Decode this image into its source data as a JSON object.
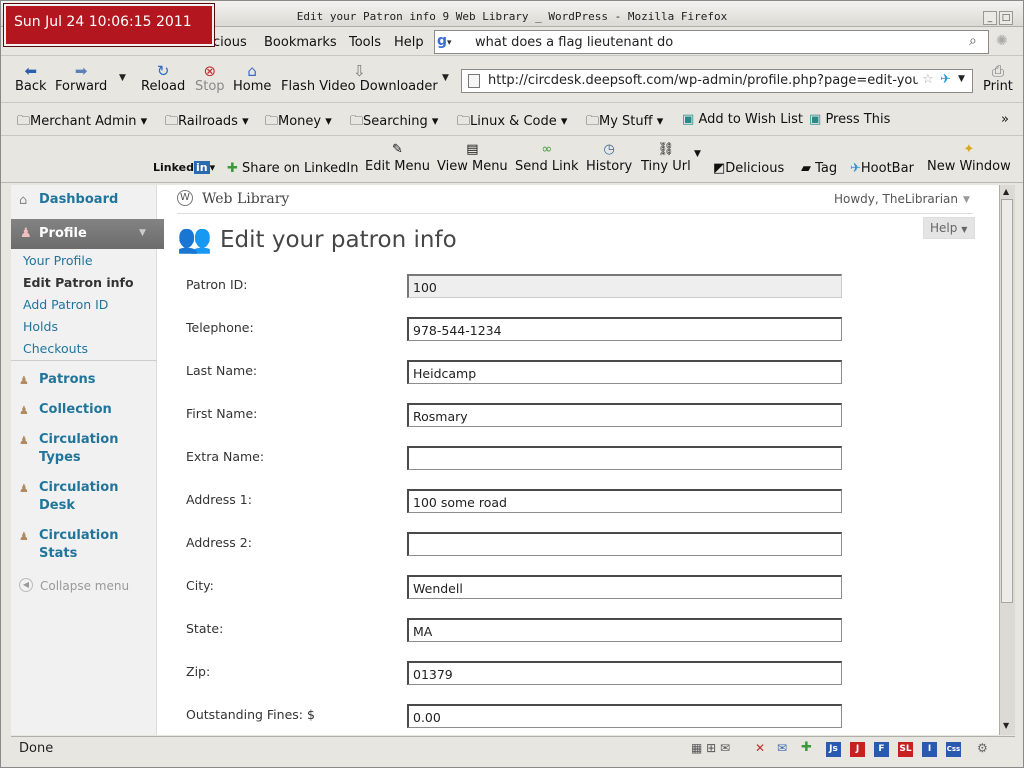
{
  "clock": "Sun Jul 24 10:06:15 2011",
  "window_title": "Edit your Patron info  9 Web Library  _ WordPress - Mozilla Firefox",
  "menu": {
    "prev": "cious",
    "bookmarks": "Bookmarks",
    "tools": "Tools",
    "help": "Help"
  },
  "search": {
    "value": "what does a flag lieutenant do"
  },
  "nav": {
    "back": "Back",
    "forward": "Forward",
    "reload": "Reload",
    "stop": "Stop",
    "home": "Home",
    "flash": "Flash Video Downloader",
    "print": "Print",
    "url": "http://circdesk.deepsoft.com/wp-admin/profile.php?page=edit-your"
  },
  "bookmarks": [
    "Merchant Admin",
    "Railroads",
    "Money",
    "Searching",
    "Linux & Code",
    "My Stuff",
    "Add to Wish List",
    "Press This"
  ],
  "toolbar": {
    "linkedin": "Linked",
    "linkedin_in": "in",
    "share": "Share on LinkedIn",
    "edit_menu": "Edit Menu",
    "view_menu": "View Menu",
    "send_link": "Send Link",
    "history": "History",
    "tiny_url": "Tiny Url",
    "delicious": "Delicious",
    "tag": "Tag",
    "hootbar": "HootBar",
    "new_window": "New Window"
  },
  "wp": {
    "site": "Web Library",
    "howdy": "Howdy, TheLibrarian",
    "help": "Help",
    "page_title": "Edit your patron info"
  },
  "sidebar": {
    "dashboard": "Dashboard",
    "profile": "Profile",
    "sub": [
      "Your Profile",
      "Edit Patron info",
      "Add Patron ID",
      "Holds",
      "Checkouts"
    ],
    "groups": [
      "Patrons",
      "Collection",
      "Circulation Types",
      "Circulation Desk",
      "Circulation Stats"
    ],
    "collapse": "Collapse menu"
  },
  "form": [
    {
      "label": "Patron ID:",
      "value": "100"
    },
    {
      "label": "Telephone:",
      "value": "978-544-1234"
    },
    {
      "label": "Last Name:",
      "value": "Heidcamp"
    },
    {
      "label": "First Name:",
      "value": "Rosmary"
    },
    {
      "label": "Extra Name:",
      "value": ""
    },
    {
      "label": "Address 1:",
      "value": "100 some road"
    },
    {
      "label": "Address 2:",
      "value": ""
    },
    {
      "label": "City:",
      "value": "Wendell"
    },
    {
      "label": "State:",
      "value": "MA"
    },
    {
      "label": "Zip:",
      "value": "01379"
    },
    {
      "label": "Outstanding Fines: $",
      "value": "0.00"
    }
  ],
  "status": "Done",
  "status_icons": [
    "Js",
    "J",
    "F",
    "SL",
    "I",
    "Css"
  ]
}
